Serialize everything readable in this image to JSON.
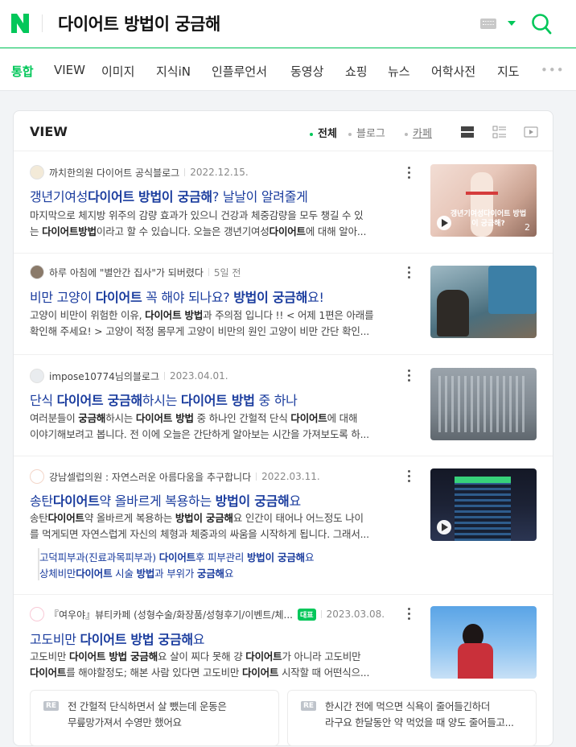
{
  "search": {
    "query": "다이어트 방법이 궁금해",
    "logo_icon": "naver-n-icon",
    "keyboard_icon": "keyboard-icon",
    "search_icon": "search-icon"
  },
  "tabs": [
    {
      "label": "통합",
      "active": true
    },
    {
      "label": "VIEW"
    },
    {
      "label": "이미지"
    },
    {
      "label": "지식iN"
    },
    {
      "label": "인플루언서"
    },
    {
      "label": "동영상"
    },
    {
      "label": "쇼핑"
    },
    {
      "label": "뉴스"
    },
    {
      "label": "어학사전"
    },
    {
      "label": "지도"
    }
  ],
  "tabs_more": "•••",
  "view_section": {
    "title": "VIEW",
    "filters": [
      {
        "label": "전체",
        "active": true
      },
      {
        "label": "블로그"
      },
      {
        "label": "카페"
      }
    ]
  },
  "results": [
    {
      "source": "까치한의원 다이어트 공식블로그",
      "date": "2022.12.15.",
      "title_parts": [
        "갱년기여성",
        "다이어트 방법이 궁금해",
        "? 날날이 알려줄게"
      ],
      "desc_line1": "마지막으로 체지방 위주의 감량 효과가 있으니 건강과 체중감량을 모두 챙길 수 있",
      "desc_line2_parts": [
        "는 ",
        "다이어트방법",
        "이라고 할 수 있습니다. 오늘은 갱년기여성",
        "다이어트",
        "에 대해 알아..."
      ],
      "thumb_caption": "갱년기여성다이어트 방법이 궁금해?",
      "thumb_count": "2"
    },
    {
      "source": "하루 아침에 \"별안간 집사\"가 되버렸다",
      "date": "5일 전",
      "title_parts": [
        "비만 고양이 ",
        "다이어트",
        " 꼭 해야 되나요? ",
        "방법이 궁금해",
        "요!"
      ],
      "desc_line1_parts": [
        "고양이 비만이 위험한 이유, ",
        "다이어트 방법",
        "과 주의점 입니다 !! < 어제 1편은 아래를"
      ],
      "desc_line2": "확인해 주세요! > 고양이 적정 몸무게 고양이 비만의 원인 고양이 비만 간단 확인..."
    },
    {
      "source": "impose10774님의블로그",
      "date": "2023.04.01.",
      "title_parts": [
        "단식 ",
        "다이어트 궁금해",
        "하시는 ",
        "다이어트 방법",
        " 중 하나"
      ],
      "desc_line1_parts": [
        "여러분들이 ",
        "궁금해",
        "하시는 ",
        "다이어트 방법",
        " 중 하나인 간헐적 단식 ",
        "다이어트",
        "에 대해"
      ],
      "desc_line2": "이야기해보려고 봅니다. 전 이에 오늘은 간단하게 알아보는 시간을 가져보도록 하..."
    },
    {
      "source": "강남셀럽의원 : 자연스러운 아름다움을 추구합니다",
      "date": "2022.03.11.",
      "title_parts": [
        "송탄",
        "다이어트",
        "약 올바르게 복용하는 ",
        "방법이 궁금해",
        "요"
      ],
      "desc_line1_parts": [
        "송탄",
        "다이어트",
        "약 올바르게 복용하는 ",
        "방법이 궁금해",
        "요 인간이 태어나 어느정도 나이"
      ],
      "desc_line2": "를 먹게되면 자연스럽게 자신의 체형과 체중과의 싸움을 시작하게 됩니다. 그래서...",
      "sub_links": [
        [
          "고덕피부과(진료과목피부과) ",
          "다이어트",
          "후 피부관리 ",
          "방법이 궁금해",
          "요"
        ],
        [
          "상체비만",
          "다이어트",
          " 시술 ",
          "방법",
          "과 부위가 ",
          "궁금해",
          "요"
        ]
      ]
    },
    {
      "source": "『여우야』뷰티카페 (성형수술/화장품/성형후기/이벤트/체...",
      "badge": "대표",
      "date": "2023.03.08.",
      "title_parts": [
        "고도비만 ",
        "다이어트 방법 궁금해",
        "요"
      ],
      "desc_line1_parts": [
        "고도비만 ",
        "다이어트 방법 궁금해",
        "요 살이 찌다 못해 걍 ",
        "다이어트",
        "가 아니라 고도비만"
      ],
      "desc_line2_parts": [
        "다이어트",
        "를 해야할정도; 해본 사람 있다면 고도비만 ",
        "다이어트",
        " 시작할 때 어떤식으..."
      ],
      "replies": [
        {
          "tag": "RE",
          "line1": "전 간헐적 단식하면서 살 뺐는데 운동은",
          "line2": "무릎망가져서 수영만 했어요"
        },
        {
          "tag": "RE",
          "line1": "한시간 전에 먹으면 식욕이 줄어들긴하더",
          "line2": "라구요 한달동안 약 먹었을 때 양도 줄어들고..."
        }
      ]
    }
  ],
  "colors": {
    "brand": "#03c75a",
    "link": "#1a3c9e"
  }
}
